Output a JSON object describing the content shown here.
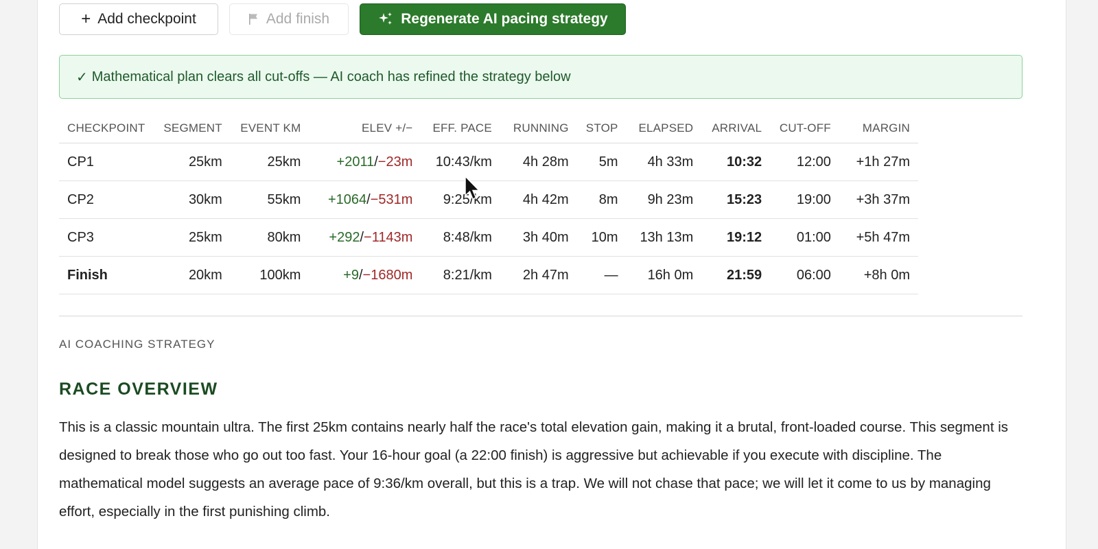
{
  "toolbar": {
    "add_checkpoint_label": "Add checkpoint",
    "add_finish_label": "Add finish",
    "regenerate_label": "Regenerate AI pacing strategy"
  },
  "alert": {
    "text": "Mathematical plan clears all cut-offs — AI coach has refined the strategy below",
    "check_glyph": "✓"
  },
  "table": {
    "headers": {
      "checkpoint": "CHECKPOINT",
      "segment": "SEGMENT",
      "event_km": "EVENT KM",
      "elev": "ELEV +/−",
      "eff_pace": "EFF. PACE",
      "running": "RUNNING",
      "stop": "STOP",
      "elapsed": "ELAPSED",
      "arrival": "ARRIVAL",
      "cutoff": "CUT-OFF",
      "margin": "MARGIN"
    },
    "rows": [
      {
        "checkpoint": "CP1",
        "segment": "25km",
        "event_km": "25km",
        "elev_up": "+2011",
        "elev_sep": "/",
        "elev_down": "−23m",
        "eff_pace": "10:43/km",
        "running": "4h 28m",
        "stop": "5m",
        "elapsed": "4h 33m",
        "arrival": "10:32",
        "cutoff": "12:00",
        "margin": "+1h 27m"
      },
      {
        "checkpoint": "CP2",
        "segment": "30km",
        "event_km": "55km",
        "elev_up": "+1064",
        "elev_sep": "/",
        "elev_down": "−531m",
        "eff_pace": "9:25/km",
        "running": "4h 42m",
        "stop": "8m",
        "elapsed": "9h 23m",
        "arrival": "15:23",
        "cutoff": "19:00",
        "margin": "+3h 37m"
      },
      {
        "checkpoint": "CP3",
        "segment": "25km",
        "event_km": "80km",
        "elev_up": "+292",
        "elev_sep": "/",
        "elev_down": "−1143m",
        "eff_pace": "8:48/km",
        "running": "3h 40m",
        "stop": "10m",
        "elapsed": "13h 13m",
        "arrival": "19:12",
        "cutoff": "01:00",
        "margin": "+5h 47m"
      },
      {
        "checkpoint": "Finish",
        "segment": "20km",
        "event_km": "100km",
        "elev_up": "+9",
        "elev_sep": "/",
        "elev_down": "−1680m",
        "eff_pace": "8:21/km",
        "running": "2h 47m",
        "stop": "—",
        "elapsed": "16h 0m",
        "arrival": "21:59",
        "cutoff": "06:00",
        "margin": "+8h 0m"
      }
    ]
  },
  "strategy": {
    "section_label": "AI COACHING STRATEGY",
    "overview_title": "RACE OVERVIEW",
    "overview_text": "This is a classic mountain ultra. The first 25km contains nearly half the race's total elevation gain, making it a brutal, front-loaded course. This segment is designed to break those who go out too fast. Your 16-hour goal (a 22:00 finish) is aggressive but achievable if you execute with discipline. The mathematical model suggests an average pace of 9:36/km overall, but this is a trap. We will not chase that pace; we will let it come to us by managing effort, especially in the first punishing climb."
  },
  "colors": {
    "primary_green": "#2c7a2c",
    "alert_bg": "#ecf9ef",
    "gain_green": "#2a6a2a",
    "loss_red": "#a02828"
  },
  "icons": [
    "plus-icon",
    "flag-icon",
    "sparkles-icon",
    "check-icon",
    "mouse-cursor-icon"
  ]
}
